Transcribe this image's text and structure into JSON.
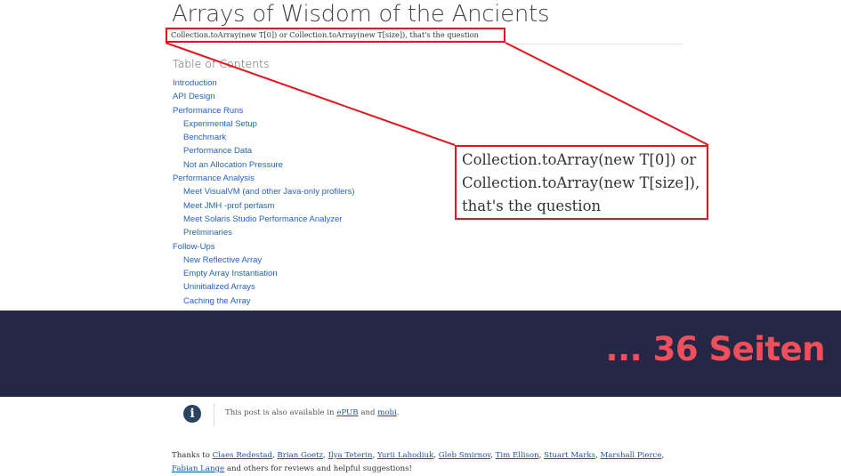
{
  "article": {
    "title": "Arrays of Wisdom of the Ancients",
    "subtitle": "Collection.toArray(new T[0]) or Collection.toArray(new T[size]), that's the question"
  },
  "toc": {
    "heading": "Table of Contents",
    "items": [
      {
        "label": "Introduction",
        "level": 1
      },
      {
        "label": "API Design",
        "level": 1
      },
      {
        "label": "Performance Runs",
        "level": 1
      },
      {
        "label": "Experimental Setup",
        "level": 2
      },
      {
        "label": "Benchmark",
        "level": 2
      },
      {
        "label": "Performance Data",
        "level": 2
      },
      {
        "label": "Not an Allocation Pressure",
        "level": 2
      },
      {
        "label": "Performance Analysis",
        "level": 1
      },
      {
        "label": "Meet VisualVM (and other Java-only profilers)",
        "level": 2
      },
      {
        "label": "Meet JMH -prof perfasm",
        "level": 2
      },
      {
        "label": "Meet Solaris Studio Performance Analyzer",
        "level": 2
      },
      {
        "label": "Preliminaries",
        "level": 2
      },
      {
        "label": "Follow-Ups",
        "level": 1
      },
      {
        "label": "New Reflective Array",
        "level": 2
      },
      {
        "label": "Empty Array Instantiation",
        "level": 2
      },
      {
        "label": "Uninitialized Arrays",
        "level": 2
      },
      {
        "label": "Caching the Array",
        "level": 2
      }
    ]
  },
  "callout": {
    "line1": "Collection.toArray(new T[0]) or",
    "line2": "Collection.toArray(new T[size]),",
    "line3": "that's the question"
  },
  "banner": {
    "text": "... 36 Seiten"
  },
  "notice": {
    "icon": "info-icon",
    "prefix": "This post is also available in ",
    "link1": "ePUB",
    "middle": " and ",
    "link2": "mobi",
    "suffix": "."
  },
  "thanks": {
    "prefix": "Thanks to ",
    "names": [
      "Claes Redestad",
      "Brian Goetz",
      "Ilya Teterin",
      "Yurii Lahodiuk",
      "Gleb Smirnov",
      "Tim Ellison",
      "Stuart Marks",
      "Marshall Pierce",
      "Fabian Lange"
    ],
    "suffix": " and others for reviews and helpful suggestions!"
  },
  "colors": {
    "highlight": "#e8141c",
    "link": "#2563c4",
    "banner_bg": "#252845",
    "banner_text": "#ee4f5d"
  }
}
